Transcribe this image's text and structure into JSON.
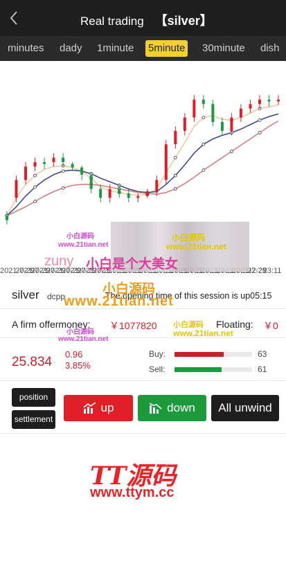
{
  "header": {
    "title": "Real trading",
    "symbol": "【silver】"
  },
  "tabs": [
    {
      "label": "minutes",
      "active": false
    },
    {
      "label": "dady",
      "active": false
    },
    {
      "label": "1minute",
      "active": false
    },
    {
      "label": "5minute",
      "active": true
    },
    {
      "label": "30minute",
      "active": false
    },
    {
      "label": "dish",
      "active": false
    }
  ],
  "chart_data": {
    "type": "line",
    "x_axis_ticks": [
      "2021-7-29",
      "2021-7-29",
      "2021-7-29",
      "2021-7-29",
      "2021-7-29",
      "2021-7-29",
      "2021-7-29",
      "2021-7-29",
      "2021-7-29",
      "2021-7-29",
      "2021-7-29",
      "2021-7-29",
      "2021-7-29",
      "2021-7-29",
      "2021-7-29",
      "2021-7-29",
      "22:25",
      "23:11"
    ],
    "ylim": [
      24.6,
      26.4
    ],
    "grid": false,
    "candles": [
      {
        "o": 24.9,
        "c": 24.85,
        "h": 24.95,
        "l": 24.8
      },
      {
        "o": 25.1,
        "c": 25.3,
        "h": 25.35,
        "l": 25.05
      },
      {
        "o": 25.3,
        "c": 25.45,
        "h": 25.5,
        "l": 25.25
      },
      {
        "o": 25.45,
        "c": 25.5,
        "h": 25.55,
        "l": 25.4
      },
      {
        "o": 25.5,
        "c": 25.48,
        "h": 25.55,
        "l": 25.42
      },
      {
        "o": 25.5,
        "c": 25.55,
        "h": 25.6,
        "l": 25.45
      },
      {
        "o": 25.55,
        "c": 25.5,
        "h": 25.6,
        "l": 25.45
      },
      {
        "o": 25.48,
        "c": 25.44,
        "h": 25.5,
        "l": 25.4
      },
      {
        "o": 25.44,
        "c": 25.36,
        "h": 25.46,
        "l": 25.3
      },
      {
        "o": 25.35,
        "c": 25.2,
        "h": 25.38,
        "l": 25.15
      },
      {
        "o": 25.2,
        "c": 25.1,
        "h": 25.25,
        "l": 25.05
      },
      {
        "o": 25.1,
        "c": 25.2,
        "h": 25.25,
        "l": 25.05
      },
      {
        "o": 25.2,
        "c": 25.15,
        "h": 25.25,
        "l": 25.1
      },
      {
        "o": 25.15,
        "c": 25.1,
        "h": 25.2,
        "l": 25.05
      },
      {
        "o": 25.1,
        "c": 25.12,
        "h": 25.15,
        "l": 25.05
      },
      {
        "o": 25.12,
        "c": 25.16,
        "h": 25.2,
        "l": 25.1
      },
      {
        "o": 25.16,
        "c": 25.3,
        "h": 25.35,
        "l": 25.12
      },
      {
        "o": 25.3,
        "c": 25.7,
        "h": 25.75,
        "l": 25.25
      },
      {
        "o": 25.7,
        "c": 25.85,
        "h": 25.9,
        "l": 25.65
      },
      {
        "o": 25.85,
        "c": 26.0,
        "h": 26.05,
        "l": 25.8
      },
      {
        "o": 26.0,
        "c": 26.2,
        "h": 26.25,
        "l": 25.95
      },
      {
        "o": 26.2,
        "c": 26.15,
        "h": 26.25,
        "l": 26.1
      },
      {
        "o": 26.15,
        "c": 25.95,
        "h": 26.2,
        "l": 25.9
      },
      {
        "o": 25.95,
        "c": 25.85,
        "h": 26.0,
        "l": 25.8
      },
      {
        "o": 25.85,
        "c": 26.0,
        "h": 26.05,
        "l": 25.8
      },
      {
        "o": 26.0,
        "c": 26.1,
        "h": 26.15,
        "l": 25.95
      },
      {
        "o": 26.1,
        "c": 26.15,
        "h": 26.2,
        "l": 26.05
      },
      {
        "o": 26.15,
        "c": 26.2,
        "h": 26.25,
        "l": 26.1
      },
      {
        "o": 26.2,
        "c": 26.18,
        "h": 26.25,
        "l": 26.12
      },
      {
        "o": 26.18,
        "c": 26.2,
        "h": 26.25,
        "l": 26.14
      }
    ],
    "series": [
      {
        "values": [
          24.9,
          25.1,
          25.25,
          25.35,
          25.42,
          25.45,
          25.46,
          25.44,
          25.4,
          25.32,
          25.22,
          25.18,
          25.16,
          25.14,
          25.13,
          25.14,
          25.2,
          25.38,
          25.55,
          25.72,
          25.9,
          26.0,
          26.02,
          25.98,
          25.97,
          26.0,
          26.05,
          26.1,
          26.12,
          26.14
        ],
        "color": "#f0c8a0"
      },
      {
        "values": [
          24.9,
          25.0,
          25.12,
          25.22,
          25.3,
          25.36,
          25.4,
          25.41,
          25.4,
          25.37,
          25.32,
          25.28,
          25.24,
          25.2,
          25.17,
          25.16,
          25.17,
          25.25,
          25.35,
          25.47,
          25.6,
          25.7,
          25.76,
          25.8,
          25.83,
          25.87,
          25.92,
          25.97,
          26.01,
          26.04
        ],
        "color": "#3f4a8c"
      },
      {
        "values": [
          24.9,
          24.95,
          25.0,
          25.06,
          25.12,
          25.17,
          25.21,
          25.24,
          25.25,
          25.25,
          25.24,
          25.22,
          25.2,
          25.18,
          25.16,
          25.15,
          25.14,
          25.16,
          25.2,
          25.26,
          25.33,
          25.41,
          25.48,
          25.55,
          25.62,
          25.69,
          25.76,
          25.83,
          25.9,
          25.96
        ],
        "color": "#d08080"
      }
    ]
  },
  "instrument": {
    "name": "silver",
    "code": "dcpp",
    "session_text": "The opening time of this session is up05:15"
  },
  "account": {
    "money_label": "A firm offermoney:",
    "money_value": "￥1077820",
    "floating_label": "Floating:",
    "floating_value": "￥0"
  },
  "quote": {
    "price": "25.834",
    "change": "0.96",
    "change_pct": "3.85%",
    "buy_label": "Buy:",
    "buy_value": "63",
    "buy_ratio": 0.63,
    "sell_label": "Sell:",
    "sell_value": "61",
    "sell_ratio": 0.61
  },
  "actions": {
    "position_label": "position",
    "settlement_label": "settlement",
    "up_label": "up",
    "down_label": "down",
    "unwind_label": "All unwind"
  },
  "watermarks": {
    "xiaobai_1": "小白源码",
    "url_1": "www.21tian.net",
    "xiaobai_2": "小白源码",
    "url_2": "www.21tian.net",
    "zuny": "zuny",
    "big_line": "小白是个大美女",
    "xiaobai_3": "小白源码",
    "url_3": "www.21tian.net",
    "xiaobai_4": "小白源码",
    "url_4": "www.21tian.net",
    "xiaobai_5": "小白源码",
    "url_5": "www.21tian.net",
    "tt_logo": "TT源码",
    "tt_url": "www.ttym.cc"
  },
  "colors": {
    "rise": "#e01e28",
    "fall": "#1c9b3d",
    "active_tab": "#f2d22a"
  }
}
